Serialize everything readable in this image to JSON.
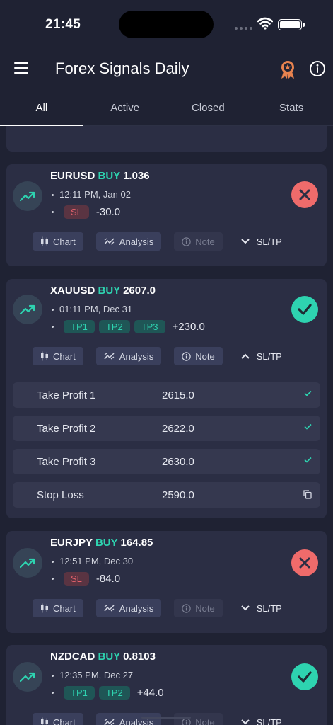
{
  "status_bar": {
    "time": "21:45"
  },
  "app": {
    "title": "Forex Signals Daily"
  },
  "tabs": [
    {
      "label": "All",
      "active": true
    },
    {
      "label": "Active",
      "active": false
    },
    {
      "label": "Closed",
      "active": false
    },
    {
      "label": "Stats",
      "active": false
    }
  ],
  "action_labels": {
    "chart": "Chart",
    "analysis": "Analysis",
    "note": "Note",
    "sltp": "SL/TP"
  },
  "signals": [
    {
      "pair": "EURUSD",
      "direction": "BUY",
      "price": "1.036",
      "time": "12:11 PM, Jan 02",
      "tags": [
        "SL"
      ],
      "pnl": "-30.0",
      "outcome": "loss",
      "note_enabled": false,
      "expanded": false
    },
    {
      "pair": "XAUUSD",
      "direction": "BUY",
      "price": "2607.0",
      "time": "01:11 PM, Dec 31",
      "tags": [
        "TP1",
        "TP2",
        "TP3"
      ],
      "pnl": "+230.0",
      "outcome": "win",
      "note_enabled": true,
      "expanded": true,
      "levels": [
        {
          "name": "Take Profit 1",
          "value": "2615.0",
          "mark": "check-icon"
        },
        {
          "name": "Take Profit 2",
          "value": "2622.0",
          "mark": "check-icon"
        },
        {
          "name": "Take Profit 3",
          "value": "2630.0",
          "mark": "check-icon"
        },
        {
          "name": "Stop Loss",
          "value": "2590.0",
          "mark": "copy-icon"
        }
      ]
    },
    {
      "pair": "EURJPY",
      "direction": "BUY",
      "price": "164.85",
      "time": "12:51 PM, Dec 30",
      "tags": [
        "SL"
      ],
      "pnl": "-84.0",
      "outcome": "loss",
      "note_enabled": false,
      "expanded": false
    },
    {
      "pair": "NZDCAD",
      "direction": "BUY",
      "price": "0.8103",
      "time": "12:35 PM, Dec 27",
      "tags": [
        "TP1",
        "TP2"
      ],
      "pnl": "+44.0",
      "outcome": "win",
      "note_enabled": false,
      "expanded": false
    }
  ],
  "colors": {
    "background": "#1f2233",
    "card": "#2b2e44",
    "buy": "#2ed3b0",
    "loss": "#ef6b6b",
    "win": "#2ed3b0"
  }
}
